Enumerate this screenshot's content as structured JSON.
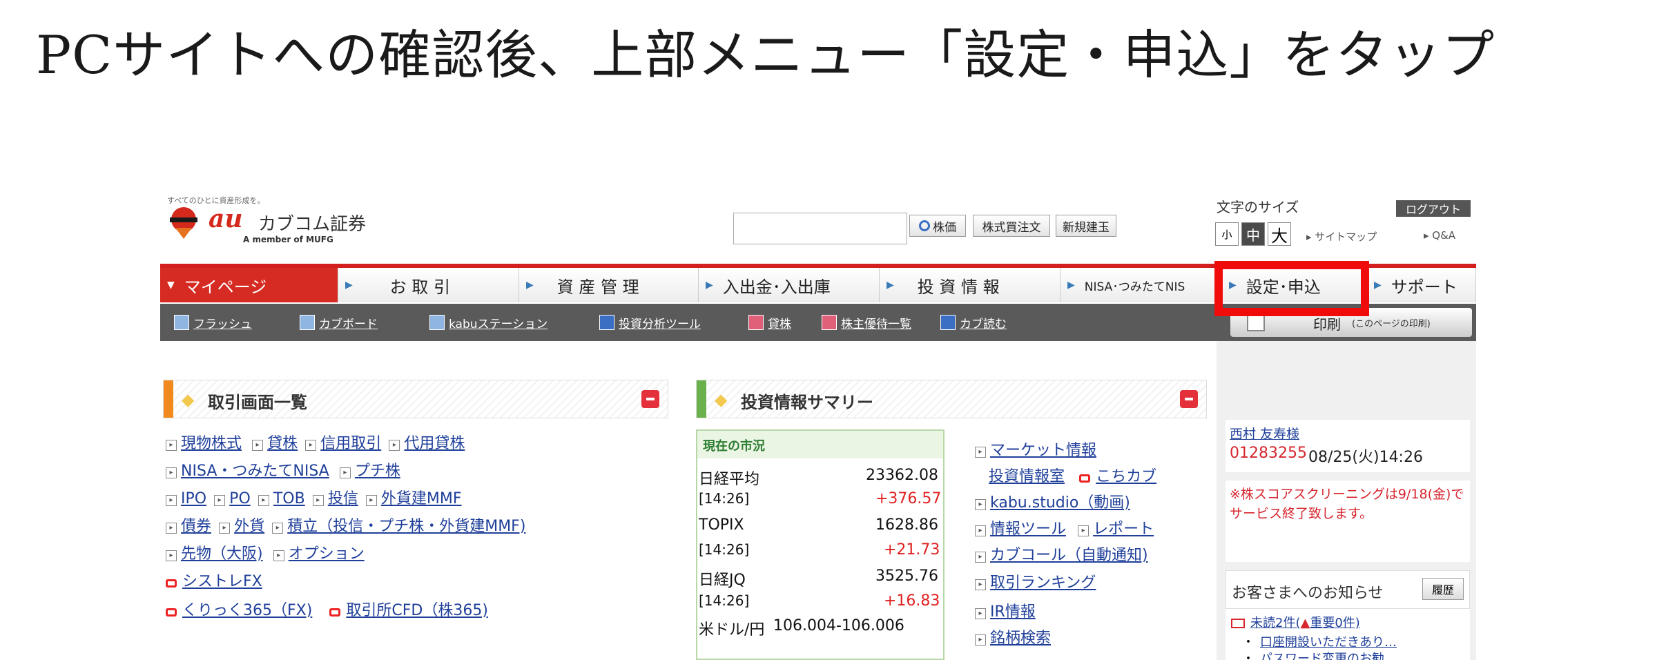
{
  "caption": "PCサイトへの確認後、上部メニュー「設定・申込」をタップ",
  "header": {
    "tagline": "すべてのひとに資産形成を。",
    "logo_au": "au",
    "logo_name": "カブコム証券",
    "logo_sub": "A member of MUFG",
    "search_placeholder": "",
    "btn_quote": "株価",
    "btn_order": "株式買注文",
    "btn_new": "新規建玉",
    "fontsize_label": "文字のサイズ",
    "fs_small": "小",
    "fs_medium": "中",
    "fs_large": "大",
    "logout": "ログアウト",
    "sitemap": "▸ サイトマップ",
    "qa": "▸ Q&A"
  },
  "nav": {
    "mypage": "マイページ",
    "trade": "お 取 引",
    "assets": "資 産 管 理",
    "inout": "入出金･入出庫",
    "info": "投 資 情 報",
    "nisa": "NISA･つみたてNIS",
    "settings": "設定･申込",
    "support": "サポート"
  },
  "subnav": {
    "flash": "フラッシュ",
    "kabuboard": "カブボード",
    "station": "kabuステーション",
    "tool": "投資分析ツール",
    "lending": "貸株",
    "yutai": "株主優待一覧",
    "kabuyomu": "カブ読む",
    "print": "印刷",
    "print_sub": "(このページの印刷)"
  },
  "trade_panel": {
    "title": "取引画面一覧",
    "r1": [
      "現物株式",
      "貸株",
      "信用取引",
      "代用貸株"
    ],
    "r2": [
      "NISA・つみたてNISA",
      "プチ株"
    ],
    "r3": [
      "IPO",
      "PO",
      "TOB",
      "投信",
      "外貨建MMF"
    ],
    "r4": [
      "債券",
      "外貨",
      "積立（投信・プチ株・外貨建MMF)"
    ],
    "r5": [
      "先物（大阪)",
      "オプション"
    ],
    "r6": "シストレFX",
    "r7": [
      "くりっく365（FX)",
      "取引所CFD（株365)"
    ]
  },
  "info_panel": {
    "title": "投資情報サマリー",
    "market_title": "現在の市況",
    "rows": [
      {
        "name": "日経平均",
        "value": "23362.08",
        "time": "[14:26]",
        "change": "+376.57"
      },
      {
        "name": "TOPIX",
        "value": "1628.86",
        "time": "[14:26]",
        "change": "+21.73"
      },
      {
        "name": "日経JQ",
        "value": "3525.76",
        "time": "[14:26]",
        "change": "+16.83"
      }
    ],
    "fx_name": "米ドル/円",
    "fx_value": "106.004-106.006",
    "links": [
      "マーケット情報",
      "投資情報室",
      "こちカブ",
      "kabu.studio（動画)",
      "情報ツール",
      "レポート",
      "カブコール（自動通知)",
      "取引ランキング",
      "IR情報",
      "銘柄検索"
    ]
  },
  "user_box": {
    "name": "西村 友寿様",
    "account": "01283255",
    "datetime": "08/25(火)14:26"
  },
  "notice_box": {
    "text": "※株スコアスクリーニングは9/18(金)でサービス終了致します。"
  },
  "oshirase": {
    "title": "お客さまへのお知らせ",
    "history": "履歴",
    "unread": "未読2件(",
    "important": "重要0件)",
    "item1": "口座開設いただきあり…",
    "item2": "パスワード変更のお勧…"
  },
  "colors": {
    "accent": "#d62b22",
    "highlight": "#f10c0c",
    "link": "#1f3f9a"
  }
}
